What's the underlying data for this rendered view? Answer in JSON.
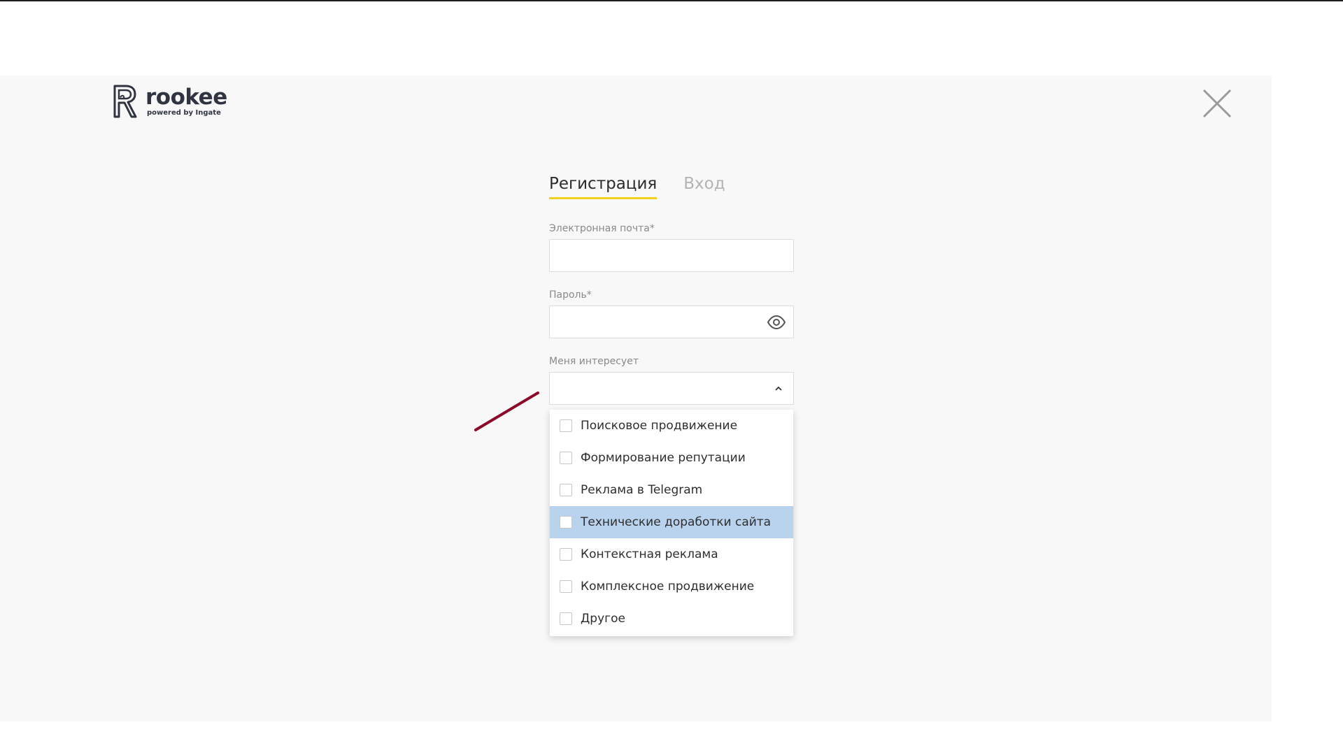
{
  "brand": {
    "name": "rookee",
    "tagline": "powered by Ingate"
  },
  "tabs": [
    {
      "label": "Регистрация",
      "active": true
    },
    {
      "label": "Вход",
      "active": false
    }
  ],
  "form": {
    "email_label": "Электронная почта*",
    "email_value": "",
    "password_label": "Пароль*",
    "password_value": "",
    "interest_label": "Меня интересует",
    "interest_value": ""
  },
  "dropdown": {
    "options": [
      {
        "label": "Поисковое продвижение",
        "checked": false
      },
      {
        "label": "Формирование репутации",
        "checked": false
      },
      {
        "label": "Реклама в Telegram",
        "checked": false
      },
      {
        "label": "Технические доработки сайта",
        "checked": false,
        "highlighted": true
      },
      {
        "label": "Контекстная реклама",
        "checked": false
      },
      {
        "label": "Комплексное продвижение",
        "checked": false
      },
      {
        "label": "Другое",
        "checked": false
      }
    ]
  },
  "colors": {
    "accent_underline": "#f3cf1e",
    "highlight_row": "#b9d3ef",
    "annotation_stroke": "#8b0a2a",
    "modal_bg": "#f8f8f9"
  },
  "icons": {
    "close": "close-icon",
    "password_toggle": "eye-icon",
    "dropdown_toggle": "chevron-up-icon"
  }
}
